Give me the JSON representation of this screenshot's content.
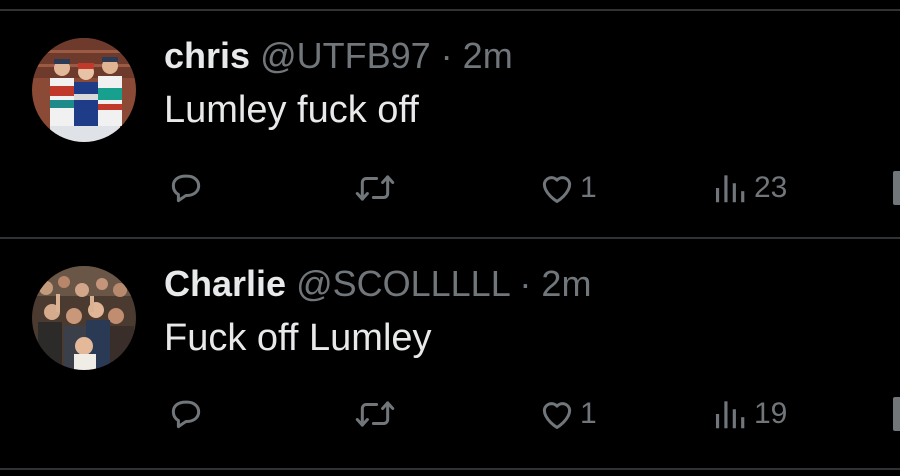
{
  "theme": {
    "background": "#000000",
    "text_primary": "#e7e9ea",
    "text_secondary": "#71767b",
    "divider": "#2f3336"
  },
  "replies": [
    {
      "display_name": "chris",
      "handle": "@UTFB97",
      "separator": "·",
      "timestamp": "2m",
      "text": "Lumley fuck off",
      "avatar_icon": "three-drivers-photo",
      "actions": {
        "reply": {
          "icon": "reply-bubble-icon",
          "count": ""
        },
        "repost": {
          "icon": "repost-arrows-icon",
          "count": ""
        },
        "like": {
          "icon": "heart-icon",
          "count": "1"
        },
        "views": {
          "icon": "bar-chart-icon",
          "count": "23"
        },
        "share": {
          "icon": "bookmark-icon"
        }
      }
    },
    {
      "display_name": "Charlie",
      "handle": "@SCOLLLLL",
      "separator": "·",
      "timestamp": "2m",
      "text": "Fuck off Lumley",
      "avatar_icon": "crowd-photo",
      "actions": {
        "reply": {
          "icon": "reply-bubble-icon",
          "count": ""
        },
        "repost": {
          "icon": "repost-arrows-icon",
          "count": ""
        },
        "like": {
          "icon": "heart-icon",
          "count": "1"
        },
        "views": {
          "icon": "bar-chart-icon",
          "count": "19"
        },
        "share": {
          "icon": "bookmark-icon"
        }
      }
    }
  ]
}
